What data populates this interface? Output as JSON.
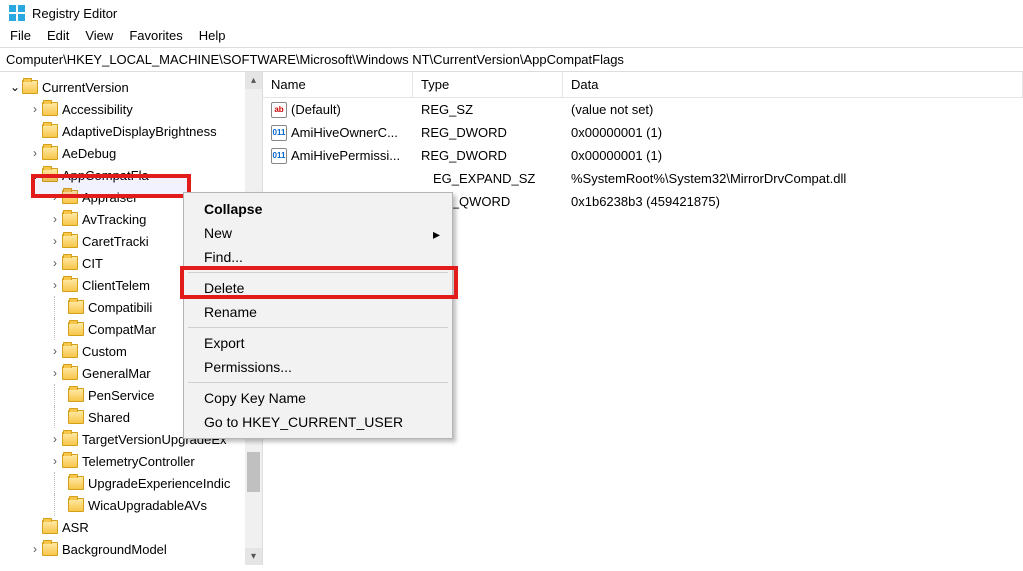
{
  "window": {
    "title": "Registry Editor"
  },
  "menu": {
    "file": "File",
    "edit": "Edit",
    "view": "View",
    "favorites": "Favorites",
    "help": "Help"
  },
  "address": "Computer\\HKEY_LOCAL_MACHINE\\SOFTWARE\\Microsoft\\Windows NT\\CurrentVersion\\AppCompatFlags",
  "tree": {
    "n0": "CurrentVersion",
    "n1": "Accessibility",
    "n2": "AdaptiveDisplayBrightness",
    "n3": "AeDebug",
    "n4": "AppCompatFla",
    "n5": "Appraiser",
    "n6": "AvTracking",
    "n7": "CaretTracki",
    "n8": "CIT",
    "n9": "ClientTelem",
    "n10": "Compatibili",
    "n11": "CompatMar",
    "n12": "Custom",
    "n13": "GeneralMar",
    "n14": "PenService",
    "n15": "Shared",
    "n16": "TargetVersionUpgradeEx",
    "n17": "TelemetryController",
    "n18": "UpgradeExperienceIndic",
    "n19": "WicaUpgradableAVs",
    "n20": "ASR",
    "n21": "BackgroundModel"
  },
  "columns": {
    "name": "Name",
    "type": "Type",
    "data": "Data"
  },
  "values": {
    "r0": {
      "name": "(Default)",
      "type": "REG_SZ",
      "data": "(value not set)"
    },
    "r1": {
      "name": "AmiHiveOwnerC...",
      "type": "REG_DWORD",
      "data": "0x00000001 (1)"
    },
    "r2": {
      "name": "AmiHivePermissi...",
      "type": "REG_DWORD",
      "data": "0x00000001 (1)"
    },
    "r3": {
      "name": "",
      "type": "EG_EXPAND_SZ",
      "data": "%SystemRoot%\\System32\\MirrorDrvCompat.dll"
    },
    "r4": {
      "name": "",
      "type": "EG_QWORD",
      "data": "0x1b6238b3 (459421875)"
    }
  },
  "context": {
    "collapse": "Collapse",
    "new": "New",
    "find": "Find...",
    "delete": "Delete",
    "rename": "Rename",
    "export": "Export",
    "permissions": "Permissions...",
    "copykey": "Copy Key Name",
    "goto": "Go to HKEY_CURRENT_USER"
  }
}
